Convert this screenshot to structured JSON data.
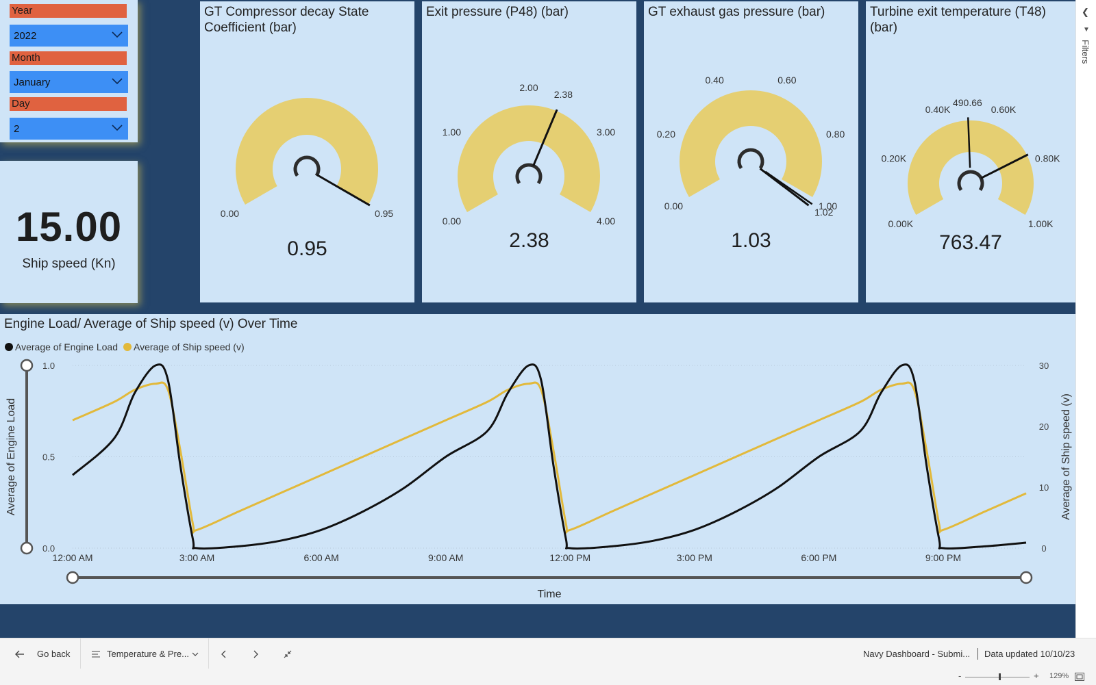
{
  "slicers": {
    "year_label": "Year",
    "year_value": "2022",
    "month_label": "Month",
    "month_value": "January",
    "day_label": "Day",
    "day_value": "2"
  },
  "card": {
    "value": "15.00",
    "label": "Ship speed (Kn)"
  },
  "gauges": [
    {
      "title": "GT Compressor decay State Coefficient (bar)",
      "value_text": "0.95",
      "value": 0.95,
      "min": 0,
      "max": 0.95,
      "target": 0.95,
      "labels": [
        {
          "t": "0.00",
          "v": 0
        },
        {
          "t": "0.95",
          "v": 0.95
        }
      ]
    },
    {
      "title": "Exit pressure (P48) (bar)",
      "value_text": "2.38",
      "value": 2.38,
      "min": 0,
      "max": 4,
      "target": 2.38,
      "labels": [
        {
          "t": "0.00",
          "v": 0
        },
        {
          "t": "1.00",
          "v": 1
        },
        {
          "t": "2.00",
          "v": 2
        },
        {
          "t": "2.38",
          "v": 2.38
        },
        {
          "t": "3.00",
          "v": 3
        },
        {
          "t": "4.00",
          "v": 4
        }
      ]
    },
    {
      "title": "GT exhaust gas pressure (bar)",
      "value_text": "1.03",
      "value": 1.03,
      "min": 0,
      "max": 1,
      "target": 1.02,
      "labels": [
        {
          "t": "0.00",
          "v": 0
        },
        {
          "t": "0.20",
          "v": 0.2
        },
        {
          "t": "0.40",
          "v": 0.4
        },
        {
          "t": "0.60",
          "v": 0.6
        },
        {
          "t": "0.80",
          "v": 0.8
        },
        {
          "t": "1.00",
          "v": 1
        },
        {
          "t": "1.02",
          "v": 1.02
        }
      ]
    },
    {
      "title": "Turbine exit temperature (T48) (bar)",
      "value_text": "763.47",
      "value": 763.47,
      "min": 0,
      "max": 1000,
      "target": 490.66,
      "labels": [
        {
          "t": "0.00K",
          "v": 0
        },
        {
          "t": "0.20K",
          "v": 200
        },
        {
          "t": "0.40K",
          "v": 400
        },
        {
          "t": "490.66",
          "v": 490.66
        },
        {
          "t": "0.60K",
          "v": 600
        },
        {
          "t": "0.80K",
          "v": 800
        },
        {
          "t": "1.00K",
          "v": 1000
        }
      ]
    }
  ],
  "line_chart": {
    "title": "Engine Load/ Average of Ship speed (v) Over Time",
    "legend": [
      "Average of Engine Load",
      "Average of Ship speed (v)"
    ],
    "xlabel": "Time",
    "ylabel_left": "Average of Engine Load",
    "ylabel_right": "Average of Ship speed (v)"
  },
  "chart_data": {
    "type": "line",
    "title": "Engine Load/ Average of Ship speed (v) Over Time",
    "xlabel": "Time",
    "ylabel": "Average of Engine Load",
    "y2label": "Average of Ship speed (v)",
    "x_ticks": [
      "12:00 AM",
      "3:00 AM",
      "6:00 AM",
      "9:00 AM",
      "12:00 PM",
      "3:00 PM",
      "6:00 PM",
      "9:00 PM"
    ],
    "ylim": [
      0,
      1
    ],
    "y2lim": [
      0,
      30
    ],
    "y_ticks": [
      "0.0",
      "0.5",
      "1.0"
    ],
    "y2_ticks": [
      "0",
      "10",
      "20",
      "30"
    ],
    "series": [
      {
        "name": "Average of Engine Load",
        "axis": "left",
        "color": "#111111",
        "x": [
          0,
          1,
          1.5,
          2,
          2.3,
          2.6,
          2.9,
          3,
          4,
          5,
          6,
          7,
          8,
          9,
          10,
          10.5,
          11,
          11.3,
          11.6,
          11.9,
          12,
          13,
          14,
          15,
          16,
          17,
          18,
          19,
          19.5,
          20,
          20.3,
          20.6,
          20.9,
          21,
          22,
          23
        ],
        "values": [
          0.4,
          0.6,
          0.85,
          1.0,
          0.92,
          0.45,
          0.05,
          0.0,
          0.01,
          0.04,
          0.1,
          0.2,
          0.33,
          0.5,
          0.64,
          0.85,
          1.0,
          0.92,
          0.45,
          0.05,
          0.0,
          0.01,
          0.04,
          0.1,
          0.2,
          0.33,
          0.5,
          0.64,
          0.85,
          1.0,
          0.92,
          0.45,
          0.05,
          0.0,
          0.01,
          0.03
        ]
      },
      {
        "name": "Average of Ship speed (v)",
        "axis": "right",
        "color": "#e2b93b",
        "x": [
          0,
          1,
          1.5,
          2,
          2.3,
          2.6,
          2.9,
          3,
          4,
          5,
          6,
          7,
          8,
          9,
          10,
          10.5,
          11,
          11.3,
          11.6,
          11.9,
          12,
          13,
          14,
          15,
          16,
          17,
          18,
          19,
          19.5,
          20,
          20.3,
          20.6,
          20.9,
          21,
          22,
          23
        ],
        "values": [
          21,
          24,
          26,
          27,
          26,
          16,
          4,
          3,
          6,
          9,
          12,
          15,
          18,
          21,
          24,
          26,
          27,
          26,
          16,
          4,
          3,
          6,
          9,
          12,
          15,
          18,
          21,
          24,
          26,
          27,
          26,
          16,
          4,
          3,
          6,
          9
        ]
      }
    ]
  },
  "bottom_bar": {
    "go_back": "Go back",
    "page_name": "Temperature & Pre...",
    "report_name": "Navy Dashboard - Submi...",
    "data_updated": "Data updated 10/10/23",
    "zoom": "129%"
  },
  "filters": {
    "label": "Filters"
  },
  "colors": {
    "canvas": "#24446a",
    "panel": "#cfe4f7",
    "gauge_fill": "#e5cf72",
    "slicer_label": "#e06240",
    "slicer_dropdown": "#3d8ff5",
    "speed_line": "#e2b93b"
  }
}
